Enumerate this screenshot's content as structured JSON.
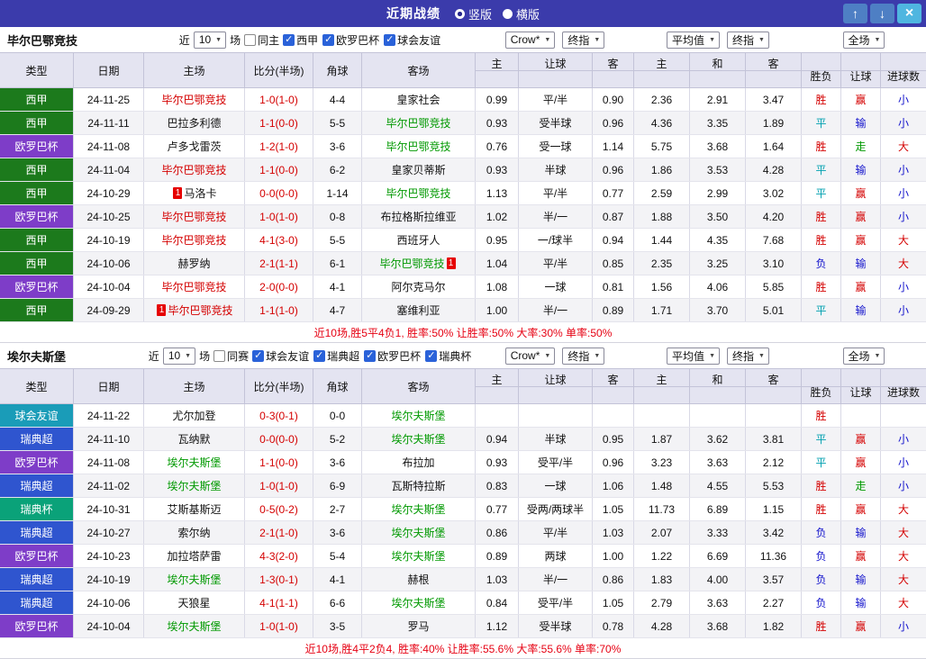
{
  "titlebar": {
    "title": "近期战绩",
    "layout_options": [
      {
        "label": "竖版",
        "selected": true
      },
      {
        "label": "横版",
        "selected": false
      }
    ],
    "buttons": {
      "up": "↑",
      "down": "↓",
      "close": "×"
    }
  },
  "palette": {
    "titlebar_bg": "#3b3bab",
    "nav_button_bg": "#4e7fc4",
    "close_button_bg": "#4fb6e0",
    "header_bg": "#e4e4f1",
    "win_red": "#d40000",
    "lose_blue": "#1414cc",
    "draw_teal": "#00a0b0",
    "push_green": "#009900"
  },
  "league_colors": {
    "西甲": "#1c7a1c",
    "欧罗巴杯": "#7e3dc8",
    "球会友谊": "#1a9cb8",
    "瑞典超": "#2f55cf",
    "瑞典杯": "#0aa279"
  },
  "columns": {
    "type": "类型",
    "date": "日期",
    "home": "主场",
    "score": "比分(半场)",
    "corner": "角球",
    "away": "客场",
    "odds_home": "主",
    "odds_handicap": "让球",
    "odds_away": "客",
    "avg_home": "主",
    "avg_draw": "和",
    "avg_away": "客",
    "result": "胜负",
    "asian": "让球",
    "goals": "进球数"
  },
  "sections": [
    {
      "team": "毕尔巴鄂竞技",
      "filter": {
        "prefix": "近",
        "count": "10",
        "suffix": "场",
        "venue_label": "同主",
        "venue_checked": false,
        "leagues": [
          {
            "label": "西甲",
            "checked": true
          },
          {
            "label": "欧罗巴杯",
            "checked": true
          },
          {
            "label": "球会友谊",
            "checked": true
          }
        ]
      },
      "selects": {
        "book": "Crow*",
        "book_final": "终指",
        "avg": "平均值",
        "avg_final": "终指",
        "scope": "全场"
      },
      "rows": [
        {
          "league": "西甲",
          "date": "24-11-25",
          "home": "毕尔巴鄂竞技",
          "home_color": "red",
          "home_card": "",
          "score": "1-0(1-0)",
          "corner": "4-4",
          "away": "皇家社会",
          "away_color": "black",
          "away_card": "",
          "odds": [
            "0.99",
            "平/半",
            "0.90",
            "2.36",
            "2.91",
            "3.47"
          ],
          "result": [
            "胜",
            "red"
          ],
          "asian": [
            "赢",
            "red"
          ],
          "goals": [
            "小",
            "blue"
          ]
        },
        {
          "league": "西甲",
          "date": "24-11-11",
          "home": "巴拉多利德",
          "home_color": "black",
          "home_card": "",
          "score": "1-1(0-0)",
          "corner": "5-5",
          "away": "毕尔巴鄂竞技",
          "away_color": "green",
          "away_card": "",
          "odds": [
            "0.93",
            "受半球",
            "0.96",
            "4.36",
            "3.35",
            "1.89"
          ],
          "result": [
            "平",
            "teal"
          ],
          "asian": [
            "输",
            "blue"
          ],
          "goals": [
            "小",
            "blue"
          ]
        },
        {
          "league": "欧罗巴杯",
          "date": "24-11-08",
          "home": "卢多戈雷茨",
          "home_color": "black",
          "home_card": "",
          "score": "1-2(1-0)",
          "corner": "3-6",
          "away": "毕尔巴鄂竞技",
          "away_color": "green",
          "away_card": "",
          "odds": [
            "0.76",
            "受一球",
            "1.14",
            "5.75",
            "3.68",
            "1.64"
          ],
          "result": [
            "胜",
            "red"
          ],
          "asian": [
            "走",
            "green"
          ],
          "goals": [
            "大",
            "red"
          ]
        },
        {
          "league": "西甲",
          "date": "24-11-04",
          "home": "毕尔巴鄂竞技",
          "home_color": "red",
          "home_card": "",
          "score": "1-1(0-0)",
          "corner": "6-2",
          "away": "皇家贝蒂斯",
          "away_color": "black",
          "away_card": "",
          "odds": [
            "0.93",
            "半球",
            "0.96",
            "1.86",
            "3.53",
            "4.28"
          ],
          "result": [
            "平",
            "teal"
          ],
          "asian": [
            "输",
            "blue"
          ],
          "goals": [
            "小",
            "blue"
          ]
        },
        {
          "league": "西甲",
          "date": "24-10-29",
          "home": "马洛卡",
          "home_color": "black",
          "home_card": "1",
          "score": "0-0(0-0)",
          "corner": "1-14",
          "away": "毕尔巴鄂竞技",
          "away_color": "green",
          "away_card": "",
          "odds": [
            "1.13",
            "平/半",
            "0.77",
            "2.59",
            "2.99",
            "3.02"
          ],
          "result": [
            "平",
            "teal"
          ],
          "asian": [
            "赢",
            "red"
          ],
          "goals": [
            "小",
            "blue"
          ]
        },
        {
          "league": "欧罗巴杯",
          "date": "24-10-25",
          "home": "毕尔巴鄂竞技",
          "home_color": "red",
          "home_card": "",
          "score": "1-0(1-0)",
          "corner": "0-8",
          "away": "布拉格斯拉维亚",
          "away_color": "black",
          "away_card": "",
          "odds": [
            "1.02",
            "半/一",
            "0.87",
            "1.88",
            "3.50",
            "4.20"
          ],
          "result": [
            "胜",
            "red"
          ],
          "asian": [
            "赢",
            "red"
          ],
          "goals": [
            "小",
            "blue"
          ]
        },
        {
          "league": "西甲",
          "date": "24-10-19",
          "home": "毕尔巴鄂竞技",
          "home_color": "red",
          "home_card": "",
          "score": "4-1(3-0)",
          "corner": "5-5",
          "away": "西班牙人",
          "away_color": "black",
          "away_card": "",
          "odds": [
            "0.95",
            "一/球半",
            "0.94",
            "1.44",
            "4.35",
            "7.68"
          ],
          "result": [
            "胜",
            "red"
          ],
          "asian": [
            "赢",
            "red"
          ],
          "goals": [
            "大",
            "red"
          ]
        },
        {
          "league": "西甲",
          "date": "24-10-06",
          "home": "赫罗纳",
          "home_color": "black",
          "home_card": "",
          "score": "2-1(1-1)",
          "corner": "6-1",
          "away": "毕尔巴鄂竞技",
          "away_color": "green",
          "away_card": "1",
          "odds": [
            "1.04",
            "平/半",
            "0.85",
            "2.35",
            "3.25",
            "3.10"
          ],
          "result": [
            "负",
            "blue"
          ],
          "asian": [
            "输",
            "blue"
          ],
          "goals": [
            "大",
            "red"
          ]
        },
        {
          "league": "欧罗巴杯",
          "date": "24-10-04",
          "home": "毕尔巴鄂竞技",
          "home_color": "red",
          "home_card": "",
          "score": "2-0(0-0)",
          "corner": "4-1",
          "away": "阿尔克马尔",
          "away_color": "black",
          "away_card": "",
          "odds": [
            "1.08",
            "一球",
            "0.81",
            "1.56",
            "4.06",
            "5.85"
          ],
          "result": [
            "胜",
            "red"
          ],
          "asian": [
            "赢",
            "red"
          ],
          "goals": [
            "小",
            "blue"
          ]
        },
        {
          "league": "西甲",
          "date": "24-09-29",
          "home": "毕尔巴鄂竞技",
          "home_color": "red",
          "home_card": "1",
          "score": "1-1(1-0)",
          "corner": "4-7",
          "away": "塞维利亚",
          "away_color": "black",
          "away_card": "",
          "odds": [
            "1.00",
            "半/一",
            "0.89",
            "1.71",
            "3.70",
            "5.01"
          ],
          "result": [
            "平",
            "teal"
          ],
          "asian": [
            "输",
            "blue"
          ],
          "goals": [
            "小",
            "blue"
          ]
        }
      ],
      "summary": "近10场,胜5平4负1, 胜率:50% 让胜率:50% 大率:30% 单率:50%"
    },
    {
      "team": "埃尔夫斯堡",
      "filter": {
        "prefix": "近",
        "count": "10",
        "suffix": "场",
        "venue_label": "同赛",
        "venue_checked": false,
        "leagues": [
          {
            "label": "球会友谊",
            "checked": true
          },
          {
            "label": "瑞典超",
            "checked": true
          },
          {
            "label": "欧罗巴杯",
            "checked": true
          },
          {
            "label": "瑞典杯",
            "checked": true
          }
        ]
      },
      "selects": {
        "book": "Crow*",
        "book_final": "终指",
        "avg": "平均值",
        "avg_final": "终指",
        "scope": "全场"
      },
      "rows": [
        {
          "league": "球会友谊",
          "date": "24-11-22",
          "home": "尤尔加登",
          "home_color": "black",
          "home_card": "",
          "score": "0-3(0-1)",
          "corner": "0-0",
          "away": "埃尔夫斯堡",
          "away_color": "green",
          "away_card": "",
          "odds": [
            "",
            "",
            "",
            "",
            "",
            ""
          ],
          "result": [
            "胜",
            "red"
          ],
          "asian": [
            "",
            ""
          ],
          "goals": [
            "",
            ""
          ]
        },
        {
          "league": "瑞典超",
          "date": "24-11-10",
          "home": "瓦纳默",
          "home_color": "black",
          "home_card": "",
          "score": "0-0(0-0)",
          "corner": "5-2",
          "away": "埃尔夫斯堡",
          "away_color": "green",
          "away_card": "",
          "odds": [
            "0.94",
            "半球",
            "0.95",
            "1.87",
            "3.62",
            "3.81"
          ],
          "result": [
            "平",
            "teal"
          ],
          "asian": [
            "赢",
            "red"
          ],
          "goals": [
            "小",
            "blue"
          ]
        },
        {
          "league": "欧罗巴杯",
          "date": "24-11-08",
          "home": "埃尔夫斯堡",
          "home_color": "green",
          "home_card": "",
          "score": "1-1(0-0)",
          "corner": "3-6",
          "away": "布拉加",
          "away_color": "black",
          "away_card": "",
          "odds": [
            "0.93",
            "受平/半",
            "0.96",
            "3.23",
            "3.63",
            "2.12"
          ],
          "result": [
            "平",
            "teal"
          ],
          "asian": [
            "赢",
            "red"
          ],
          "goals": [
            "小",
            "blue"
          ]
        },
        {
          "league": "瑞典超",
          "date": "24-11-02",
          "home": "埃尔夫斯堡",
          "home_color": "green",
          "home_card": "",
          "score": "1-0(1-0)",
          "corner": "6-9",
          "away": "瓦斯特拉斯",
          "away_color": "black",
          "away_card": "",
          "odds": [
            "0.83",
            "一球",
            "1.06",
            "1.48",
            "4.55",
            "5.53"
          ],
          "result": [
            "胜",
            "red"
          ],
          "asian": [
            "走",
            "green"
          ],
          "goals": [
            "小",
            "blue"
          ]
        },
        {
          "league": "瑞典杯",
          "date": "24-10-31",
          "home": "艾斯基斯迈",
          "home_color": "black",
          "home_card": "",
          "score": "0-5(0-2)",
          "corner": "2-7",
          "away": "埃尔夫斯堡",
          "away_color": "green",
          "away_card": "",
          "odds": [
            "0.77",
            "受两/两球半",
            "1.05",
            "11.73",
            "6.89",
            "1.15"
          ],
          "result": [
            "胜",
            "red"
          ],
          "asian": [
            "赢",
            "red"
          ],
          "goals": [
            "大",
            "red"
          ]
        },
        {
          "league": "瑞典超",
          "date": "24-10-27",
          "home": "索尔纳",
          "home_color": "black",
          "home_card": "",
          "score": "2-1(1-0)",
          "corner": "3-6",
          "away": "埃尔夫斯堡",
          "away_color": "green",
          "away_card": "",
          "odds": [
            "0.86",
            "平/半",
            "1.03",
            "2.07",
            "3.33",
            "3.42"
          ],
          "result": [
            "负",
            "blue"
          ],
          "asian": [
            "输",
            "blue"
          ],
          "goals": [
            "大",
            "red"
          ]
        },
        {
          "league": "欧罗巴杯",
          "date": "24-10-23",
          "home": "加拉塔萨雷",
          "home_color": "black",
          "home_card": "",
          "score": "4-3(2-0)",
          "corner": "5-4",
          "away": "埃尔夫斯堡",
          "away_color": "green",
          "away_card": "",
          "odds": [
            "0.89",
            "两球",
            "1.00",
            "1.22",
            "6.69",
            "11.36"
          ],
          "result": [
            "负",
            "blue"
          ],
          "asian": [
            "赢",
            "red"
          ],
          "goals": [
            "大",
            "red"
          ]
        },
        {
          "league": "瑞典超",
          "date": "24-10-19",
          "home": "埃尔夫斯堡",
          "home_color": "green",
          "home_card": "",
          "score": "1-3(0-1)",
          "corner": "4-1",
          "away": "赫根",
          "away_color": "black",
          "away_card": "",
          "odds": [
            "1.03",
            "半/一",
            "0.86",
            "1.83",
            "4.00",
            "3.57"
          ],
          "result": [
            "负",
            "blue"
          ],
          "asian": [
            "输",
            "blue"
          ],
          "goals": [
            "大",
            "red"
          ]
        },
        {
          "league": "瑞典超",
          "date": "24-10-06",
          "home": "天狼星",
          "home_color": "black",
          "home_card": "",
          "score": "4-1(1-1)",
          "corner": "6-6",
          "away": "埃尔夫斯堡",
          "away_color": "green",
          "away_card": "",
          "odds": [
            "0.84",
            "受平/半",
            "1.05",
            "2.79",
            "3.63",
            "2.27"
          ],
          "result": [
            "负",
            "blue"
          ],
          "asian": [
            "输",
            "blue"
          ],
          "goals": [
            "大",
            "red"
          ]
        },
        {
          "league": "欧罗巴杯",
          "date": "24-10-04",
          "home": "埃尔夫斯堡",
          "home_color": "green",
          "home_card": "",
          "score": "1-0(1-0)",
          "corner": "3-5",
          "away": "罗马",
          "away_color": "black",
          "away_card": "",
          "odds": [
            "1.12",
            "受半球",
            "0.78",
            "4.28",
            "3.68",
            "1.82"
          ],
          "result": [
            "胜",
            "red"
          ],
          "asian": [
            "赢",
            "red"
          ],
          "goals": [
            "小",
            "blue"
          ]
        }
      ],
      "summary": "近10场,胜4平2负4, 胜率:40% 让胜率:55.6% 大率:55.6% 单率:70%"
    }
  ]
}
